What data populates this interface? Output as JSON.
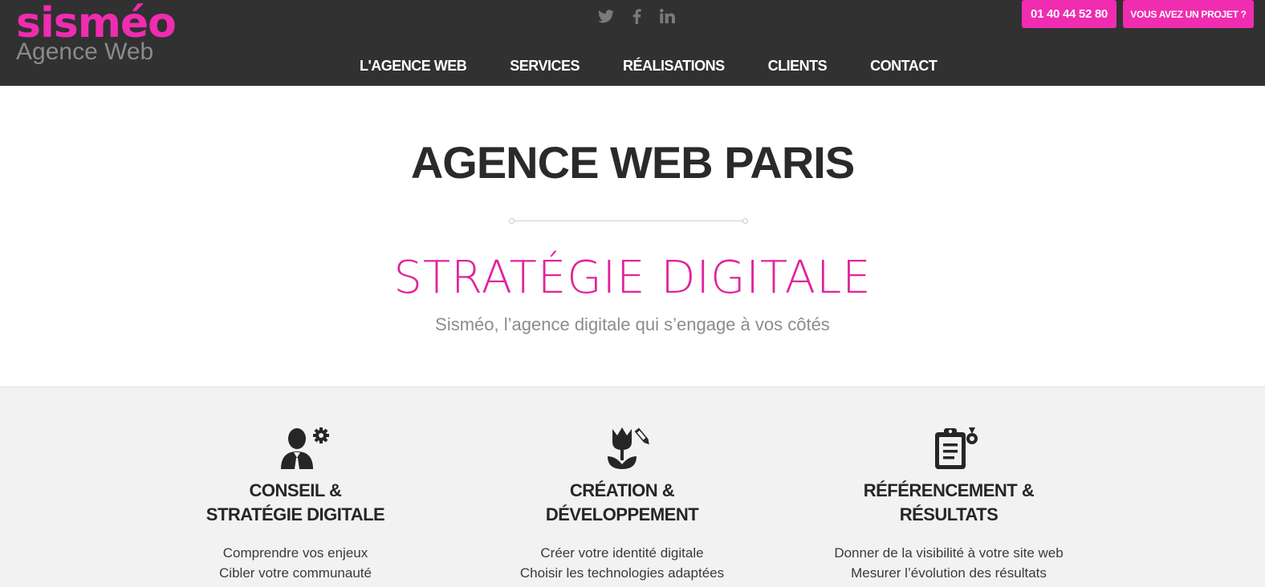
{
  "brand": {
    "name": "sisméo",
    "tagline": "Agence Web",
    "accent_color": "#f02cb1",
    "header_bg": "#313131"
  },
  "social": [
    {
      "icon": "twitter-icon",
      "label": "Twitter"
    },
    {
      "icon": "facebook-icon",
      "label": "Facebook"
    },
    {
      "icon": "linkedin-icon",
      "label": "LinkedIn"
    }
  ],
  "nav": {
    "items": [
      "L'AGENCE WEB",
      "SERVICES",
      "RÉALISATIONS",
      "CLIENTS",
      "CONTACT"
    ]
  },
  "cta": {
    "phone": "01 40 44 52 80",
    "project": "VOUS AVEZ UN PROJET ?"
  },
  "hero": {
    "title": "AGENCE WEB PARIS",
    "subtitle": "STRATÉGIE DIGITALE",
    "tagline": "Sisméo, l’agence digitale qui s’engage à vos côtés"
  },
  "services": [
    {
      "icon": "consultant-gear-icon",
      "title_line1": "CONSEIL &",
      "title_line2": "STRATÉGIE DIGITALE",
      "desc_line1": "Comprendre vos enjeux",
      "desc_line2": "Cibler votre communauté"
    },
    {
      "icon": "tulip-pencil-icon",
      "title_line1": "CRÉATION &",
      "title_line2": "DÉVELOPPEMENT",
      "desc_line1": "Créer votre identité digitale",
      "desc_line2": "Choisir les technologies adaptées"
    },
    {
      "icon": "clipboard-medal-icon",
      "title_line1": "RÉFÉRENCEMENT &",
      "title_line2": "RÉSULTATS",
      "desc_line1": "Donner de la visibilité à votre site web",
      "desc_line2": "Mesurer l’évolution des résultats"
    }
  ]
}
